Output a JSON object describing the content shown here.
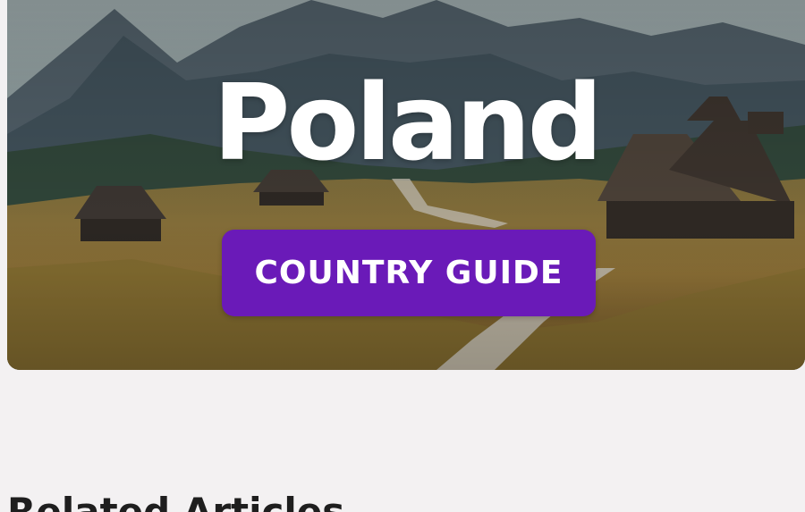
{
  "hero": {
    "title": "Poland",
    "badge_label": "COUNTRY GUIDE",
    "badge_color": "#6a1ab8",
    "image": "mountain-valley-cabins-photo"
  },
  "related": {
    "heading": "Related Articles"
  }
}
